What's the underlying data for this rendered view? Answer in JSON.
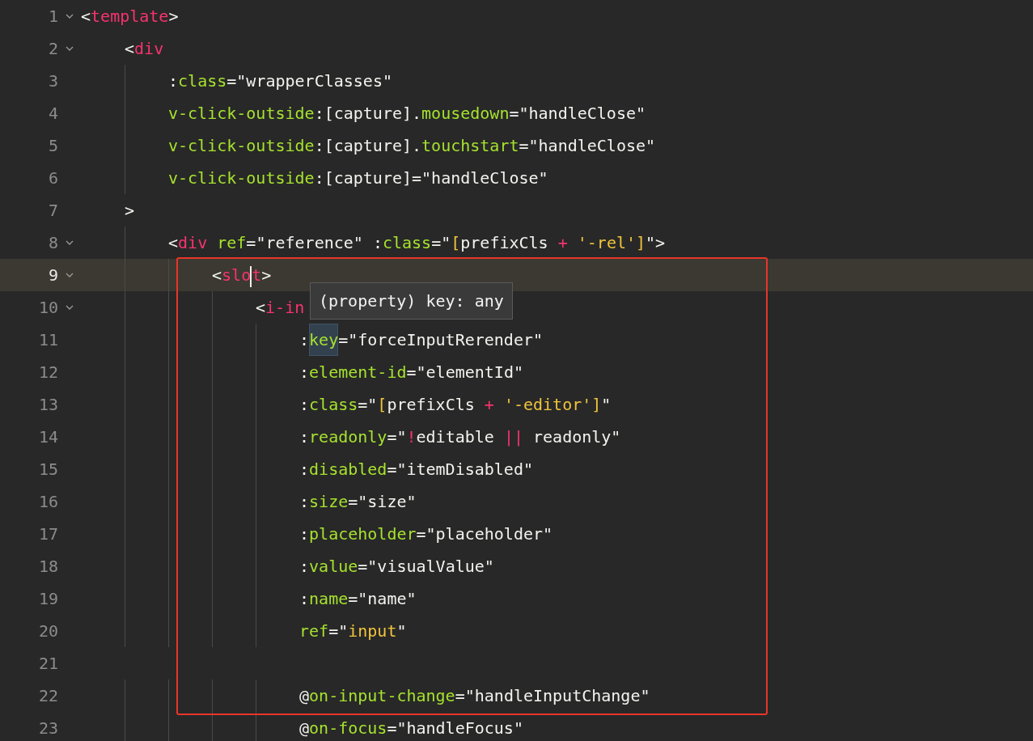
{
  "lines": [
    {
      "number": "1",
      "foldable": true,
      "current": false,
      "tokens": [
        {
          "kind": "plain",
          "text": "<"
        },
        {
          "kind": "tag",
          "text": "template"
        },
        {
          "kind": "plain",
          "text": ">"
        }
      ]
    },
    {
      "number": "2",
      "foldable": true,
      "current": false,
      "tokens": [
        {
          "kind": "plain",
          "text": "\t<"
        },
        {
          "kind": "tag",
          "text": "div"
        }
      ]
    },
    {
      "number": "3",
      "foldable": false,
      "current": false,
      "tokens": [
        {
          "kind": "plain",
          "text": "\t\t:"
        },
        {
          "kind": "attr",
          "text": "class"
        },
        {
          "kind": "plain",
          "text": "=\"wrapperClasses\""
        }
      ]
    },
    {
      "number": "4",
      "foldable": false,
      "current": false,
      "tokens": [
        {
          "kind": "attr",
          "text": "\t\tv-click-outside"
        },
        {
          "kind": "plain",
          "text": ":[capture]."
        },
        {
          "kind": "attr",
          "text": "mousedown"
        },
        {
          "kind": "plain",
          "text": "=\"handleClose\""
        }
      ]
    },
    {
      "number": "5",
      "foldable": false,
      "current": false,
      "tokens": [
        {
          "kind": "attr",
          "text": "\t\tv-click-outside"
        },
        {
          "kind": "plain",
          "text": ":[capture]."
        },
        {
          "kind": "attr",
          "text": "touchstart"
        },
        {
          "kind": "plain",
          "text": "=\"handleClose\""
        }
      ]
    },
    {
      "number": "6",
      "foldable": false,
      "current": false,
      "tokens": [
        {
          "kind": "attr",
          "text": "\t\tv-click-outside"
        },
        {
          "kind": "plain",
          "text": ":[capture]=\"handleClose\""
        }
      ]
    },
    {
      "number": "7",
      "foldable": false,
      "current": false,
      "tokens": [
        {
          "kind": "plain",
          "text": "\t>"
        }
      ]
    },
    {
      "number": "8",
      "foldable": true,
      "current": false,
      "tokens": [
        {
          "kind": "plain",
          "text": "\t\t<"
        },
        {
          "kind": "tag",
          "text": "div"
        },
        {
          "kind": "attr",
          "text": " ref"
        },
        {
          "kind": "plain",
          "text": "=\"reference\" :"
        },
        {
          "kind": "attr",
          "text": "class"
        },
        {
          "kind": "plain",
          "text": "=\""
        },
        {
          "kind": "literal",
          "text": "["
        },
        {
          "kind": "plain",
          "text": "prefixCls "
        },
        {
          "kind": "operator",
          "text": "+"
        },
        {
          "kind": "literal",
          "text": " '-rel']"
        },
        {
          "kind": "plain",
          "text": "\">"
        }
      ]
    },
    {
      "number": "9",
      "foldable": true,
      "current": true,
      "tokens": [
        {
          "kind": "plain",
          "text": "\t\t\t<"
        },
        {
          "kind": "tag",
          "text": "slo",
          "cursor": true
        },
        {
          "kind": "tag",
          "text": "t"
        },
        {
          "kind": "plain",
          "text": ">"
        }
      ]
    },
    {
      "number": "10",
      "foldable": true,
      "current": false,
      "tokens": [
        {
          "kind": "plain",
          "text": "\t\t\t\t<"
        },
        {
          "kind": "tag",
          "text": "i-in"
        }
      ]
    },
    {
      "number": "11",
      "foldable": false,
      "current": false,
      "tokens": [
        {
          "kind": "plain",
          "text": "\t\t\t\t\t:"
        },
        {
          "kind": "attr",
          "text": "key",
          "highlight": true
        },
        {
          "kind": "plain",
          "text": "=\"forceInputRerender\""
        }
      ]
    },
    {
      "number": "12",
      "foldable": false,
      "current": false,
      "tokens": [
        {
          "kind": "plain",
          "text": "\t\t\t\t\t:"
        },
        {
          "kind": "attr",
          "text": "element-id"
        },
        {
          "kind": "plain",
          "text": "=\"elementId\""
        }
      ]
    },
    {
      "number": "13",
      "foldable": false,
      "current": false,
      "tokens": [
        {
          "kind": "plain",
          "text": "\t\t\t\t\t:"
        },
        {
          "kind": "attr",
          "text": "class"
        },
        {
          "kind": "plain",
          "text": "=\""
        },
        {
          "kind": "literal",
          "text": "["
        },
        {
          "kind": "plain",
          "text": "prefixCls "
        },
        {
          "kind": "operator",
          "text": "+"
        },
        {
          "kind": "literal",
          "text": " '-editor']"
        },
        {
          "kind": "plain",
          "text": "\""
        }
      ]
    },
    {
      "number": "14",
      "foldable": false,
      "current": false,
      "tokens": [
        {
          "kind": "plain",
          "text": "\t\t\t\t\t:"
        },
        {
          "kind": "attr",
          "text": "readonly"
        },
        {
          "kind": "plain",
          "text": "=\""
        },
        {
          "kind": "operator",
          "text": "!"
        },
        {
          "kind": "plain",
          "text": "editable "
        },
        {
          "kind": "operator",
          "text": "||"
        },
        {
          "kind": "plain",
          "text": " readonly\""
        }
      ]
    },
    {
      "number": "15",
      "foldable": false,
      "current": false,
      "tokens": [
        {
          "kind": "plain",
          "text": "\t\t\t\t\t:"
        },
        {
          "kind": "attr",
          "text": "disabled"
        },
        {
          "kind": "plain",
          "text": "=\"itemDisabled\""
        }
      ]
    },
    {
      "number": "16",
      "foldable": false,
      "current": false,
      "tokens": [
        {
          "kind": "plain",
          "text": "\t\t\t\t\t:"
        },
        {
          "kind": "attr",
          "text": "size"
        },
        {
          "kind": "plain",
          "text": "=\"size\""
        }
      ]
    },
    {
      "number": "17",
      "foldable": false,
      "current": false,
      "tokens": [
        {
          "kind": "plain",
          "text": "\t\t\t\t\t:"
        },
        {
          "kind": "attr",
          "text": "placeholder"
        },
        {
          "kind": "plain",
          "text": "=\"placeholder\""
        }
      ]
    },
    {
      "number": "18",
      "foldable": false,
      "current": false,
      "tokens": [
        {
          "kind": "plain",
          "text": "\t\t\t\t\t:"
        },
        {
          "kind": "attr",
          "text": "value"
        },
        {
          "kind": "plain",
          "text": "=\"visualValue\""
        }
      ]
    },
    {
      "number": "19",
      "foldable": false,
      "current": false,
      "tokens": [
        {
          "kind": "plain",
          "text": "\t\t\t\t\t:"
        },
        {
          "kind": "attr",
          "text": "name"
        },
        {
          "kind": "plain",
          "text": "=\"name\""
        }
      ]
    },
    {
      "number": "20",
      "foldable": false,
      "current": false,
      "tokens": [
        {
          "kind": "attr",
          "text": "\t\t\t\t\tref"
        },
        {
          "kind": "plain",
          "text": "=\""
        },
        {
          "kind": "literal",
          "text": "input"
        },
        {
          "kind": "plain",
          "text": "\""
        }
      ]
    },
    {
      "number": "21",
      "foldable": false,
      "current": false
    },
    {
      "number": "22",
      "foldable": false,
      "current": false,
      "tokens": [
        {
          "kind": "plain",
          "text": "\t\t\t\t\t@"
        },
        {
          "kind": "attr",
          "text": "on-input-change"
        },
        {
          "kind": "plain",
          "text": "=\"handleInputChange\""
        }
      ]
    },
    {
      "number": "23",
      "foldable": false,
      "current": false,
      "tokens": [
        {
          "kind": "plain",
          "text": "\t\t\t\t\t@"
        },
        {
          "kind": "attr",
          "text": "on-focus"
        },
        {
          "kind": "plain",
          "text": "=\"handleFocus\""
        }
      ]
    }
  ],
  "tooltip": {
    "text": "(property) key: any"
  }
}
